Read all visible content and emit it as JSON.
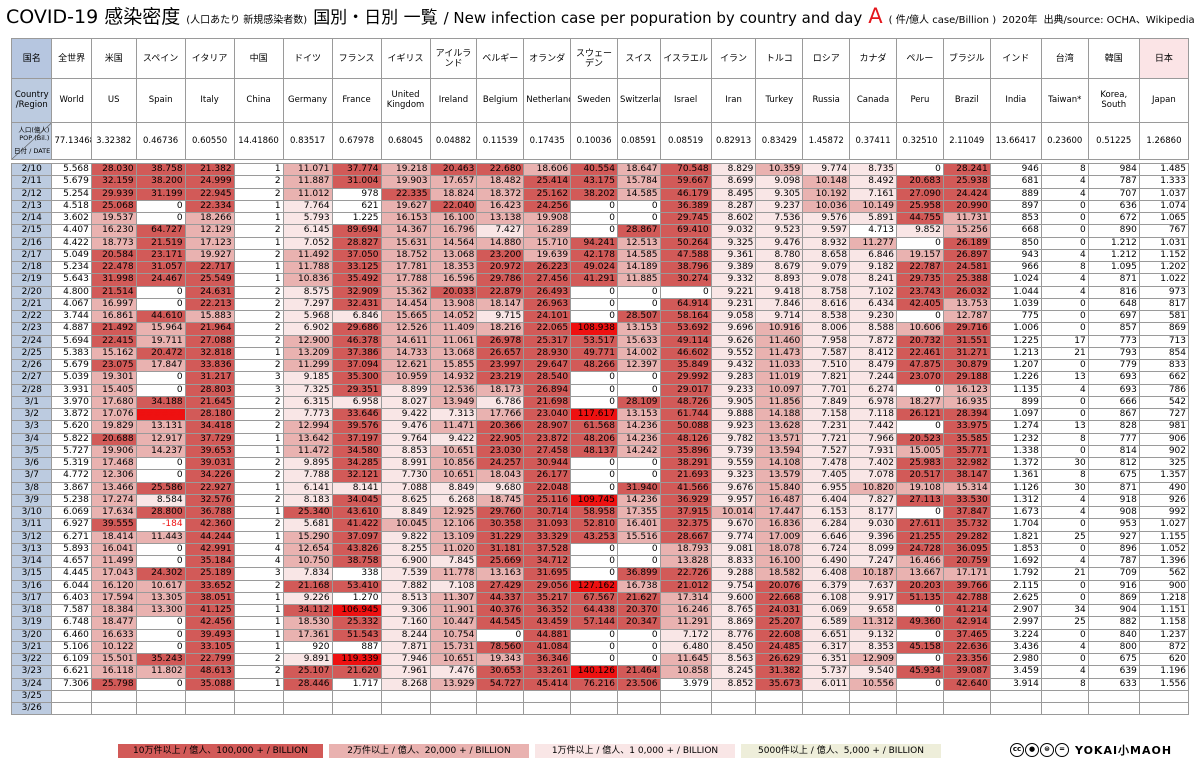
{
  "title": {
    "main": "COVID-19 感染密度",
    "paren": "(人口あたり 新規感染者数)",
    "sub": "国別・日別 一覧",
    "english": "/ New infection case per popuration by country and day",
    "letter": "A",
    "unit": "( 件/億人 case/Billion )",
    "year": "2020年",
    "source": "出典/source: OCHA、Wikipedia"
  },
  "header": {
    "corner_jp": "国名",
    "corner_en": "Country /Region",
    "corner_pop_a": "人口(億人)",
    "corner_pop_b": "POP (Bil.)",
    "corner_date": "日付 / DATE",
    "countries_jp": [
      "全世界",
      "米国",
      "スペイン",
      "イタリア",
      "中国",
      "ドイツ",
      "フランス",
      "イギリス",
      "アイルランド",
      "ベルギー",
      "オランダ",
      "スウェーデン",
      "スイス",
      "イスラエル",
      "イラン",
      "トルコ",
      "ロシア",
      "カナダ",
      "ペルー",
      "ブラジル",
      "インド",
      "台湾",
      "韓国",
      "日本"
    ],
    "countries_en": [
      "World",
      "US",
      "Spain",
      "Italy",
      "China",
      "Germany",
      "France",
      "United Kingdom",
      "Ireland",
      "Belgium",
      "Netherlands",
      "Sweden",
      "Switzerland",
      "Israel",
      "Iran",
      "Turkey",
      "Russia",
      "Canada",
      "Peru",
      "Brazil",
      "India",
      "Taiwan*",
      "Korea, South",
      "Japan"
    ],
    "population": [
      "77.13468",
      "3.32382",
      "0.46736",
      "0.60550",
      "14.41860",
      "0.83517",
      "0.67978",
      "0.68045",
      "0.04882",
      "0.11539",
      "0.17435",
      "0.10036",
      "0.08591",
      "0.08519",
      "0.82913",
      "0.83429",
      "1.45872",
      "0.37411",
      "0.32510",
      "2.11049",
      "13.66417",
      "0.23600",
      "0.51225",
      "1.26860"
    ]
  },
  "rows": [
    [
      "2/10",
      "5.568",
      "28.030",
      "38.758",
      "21.382",
      "1",
      "11.071",
      "37.774",
      "19.218",
      "20.463",
      "22.680",
      "18.606",
      "40.554",
      "18.647",
      "70.548",
      "8.829",
      "10.359",
      "9.774",
      "8.735",
      "0",
      "28.241",
      "946",
      "8",
      "984",
      "1.485"
    ],
    [
      "2/11",
      "5.679",
      "32.159",
      "38.200",
      "24.999",
      "2",
      "11.887",
      "31.004",
      "19.903",
      "17.657",
      "18.482",
      "25.414",
      "43.175",
      "15.784",
      "59.667",
      "8.699",
      "9.098",
      "10.148",
      "8.492",
      "20.683",
      "25.938",
      "681",
      "4",
      "787",
      "1.333"
    ],
    [
      "2/12",
      "5.254",
      "29.939",
      "31.199",
      "22.945",
      "2",
      "11.012",
      "978",
      "22.335",
      "18.824",
      "18.372",
      "25.162",
      "38.202",
      "14.585",
      "46.179",
      "8.495",
      "9.305",
      "10.192",
      "7.161",
      "27.090",
      "24.424",
      "889",
      "4",
      "707",
      "1.037"
    ],
    [
      "2/13",
      "4.518",
      "25.068",
      "0",
      "22.334",
      "1",
      "7.764",
      "621",
      "19.627",
      "22.040",
      "16.423",
      "24.256",
      "0",
      "0",
      "36.389",
      "8.287",
      "9.237",
      "10.036",
      "10.149",
      "25.958",
      "20.990",
      "897",
      "0",
      "636",
      "1.074"
    ],
    [
      "2/14",
      "3.602",
      "19.537",
      "0",
      "18.266",
      "1",
      "5.793",
      "1.225",
      "16.153",
      "16.100",
      "13.138",
      "19.908",
      "0",
      "0",
      "29.745",
      "8.602",
      "7.536",
      "9.576",
      "5.891",
      "44.755",
      "11.731",
      "853",
      "0",
      "672",
      "1.065"
    ],
    [
      "2/15",
      "4.407",
      "16.230",
      "64.727",
      "12.129",
      "2",
      "6.145",
      "89.694",
      "14.367",
      "16.796",
      "7.427",
      "16.289",
      "0",
      "28.867",
      "69.410",
      "9.032",
      "9.523",
      "9.597",
      "4.713",
      "9.852",
      "15.256",
      "668",
      "0",
      "890",
      "767"
    ],
    [
      "2/16",
      "4.422",
      "18.773",
      "21.519",
      "17.123",
      "1",
      "7.052",
      "28.827",
      "15.631",
      "14.564",
      "14.880",
      "15.710",
      "94.241",
      "12.513",
      "50.264",
      "9.325",
      "9.476",
      "8.932",
      "11.277",
      "0",
      "26.189",
      "850",
      "0",
      "1.212",
      "1.031"
    ],
    [
      "2/17",
      "5.049",
      "20.584",
      "23.171",
      "19.927",
      "2",
      "11.492",
      "37.050",
      "18.752",
      "13.068",
      "23.200",
      "19.639",
      "42.178",
      "14.585",
      "47.588",
      "9.361",
      "8.780",
      "8.658",
      "6.846",
      "19.157",
      "26.897",
      "943",
      "4",
      "1.212",
      "1.152"
    ],
    [
      "2/18",
      "5.234",
      "22.478",
      "31.057",
      "22.717",
      "1",
      "11.788",
      "33.125",
      "17.781",
      "18.353",
      "20.972",
      "26.223",
      "49.024",
      "14.189",
      "38.796",
      "9.389",
      "8.679",
      "9.079",
      "9.182",
      "22.787",
      "24.581",
      "966",
      "8",
      "1.095",
      "1.202"
    ],
    [
      "2/19",
      "5.643",
      "31.998",
      "24.467",
      "25.549",
      "1",
      "10.836",
      "35.492",
      "17.788",
      "16.596",
      "29.786",
      "27.456",
      "41.291",
      "11.885",
      "30.274",
      "9.332",
      "8.893",
      "9.078",
      "8.241",
      "29.735",
      "25.388",
      "1.024",
      "4",
      "871",
      "1.022"
    ],
    [
      "2/20",
      "4.800",
      "21.514",
      "0",
      "24.631",
      "2",
      "8.575",
      "32.909",
      "15.362",
      "20.033",
      "22.879",
      "26.493",
      "0",
      "0",
      "0",
      "9.221",
      "9.418",
      "8.758",
      "7.102",
      "23.743",
      "26.032",
      "1.044",
      "4",
      "816",
      "973"
    ],
    [
      "2/21",
      "4.067",
      "16.997",
      "0",
      "22.213",
      "2",
      "7.297",
      "32.431",
      "14.454",
      "13.908",
      "18.147",
      "26.963",
      "0",
      "0",
      "64.914",
      "9.231",
      "7.846",
      "8.616",
      "6.434",
      "42.405",
      "13.753",
      "1.039",
      "0",
      "648",
      "817"
    ],
    [
      "2/22",
      "3.744",
      "16.861",
      "44.610",
      "15.883",
      "2",
      "5.968",
      "6.846",
      "15.665",
      "14.052",
      "9.715",
      "24.101",
      "0",
      "28.507",
      "58.164",
      "9.058",
      "9.714",
      "8.538",
      "9.230",
      "0",
      "12.787",
      "775",
      "0",
      "697",
      "581"
    ],
    [
      "2/23",
      "4.887",
      "21.492",
      "15.964",
      "21.964",
      "2",
      "6.902",
      "29.686",
      "12.526",
      "11.409",
      "18.216",
      "22.065",
      "108.938",
      "13.153",
      "53.692",
      "9.696",
      "10.916",
      "8.006",
      "8.588",
      "10.606",
      "29.716",
      "1.006",
      "0",
      "857",
      "869"
    ],
    [
      "2/24",
      "5.694",
      "22.415",
      "19.711",
      "27.088",
      "2",
      "12.900",
      "46.378",
      "14.611",
      "11.061",
      "26.978",
      "25.317",
      "53.517",
      "15.633",
      "49.114",
      "9.626",
      "11.460",
      "7.958",
      "7.872",
      "20.732",
      "31.551",
      "1.225",
      "17",
      "773",
      "713"
    ],
    [
      "2/25",
      "5.383",
      "15.162",
      "20.472",
      "32.818",
      "1",
      "13.209",
      "37.386",
      "14.733",
      "13.068",
      "26.657",
      "28.930",
      "49.771",
      "14.002",
      "46.602",
      "9.552",
      "11.473",
      "7.587",
      "8.412",
      "22.461",
      "31.271",
      "1.213",
      "21",
      "793",
      "854"
    ],
    [
      "2/26",
      "5.679",
      "23.075",
      "17.847",
      "33.836",
      "2",
      "11.299",
      "37.094",
      "12.621",
      "15.855",
      "23.997",
      "29.647",
      "48.266",
      "12.397",
      "35.849",
      "9.432",
      "11.033",
      "7.510",
      "8.479",
      "47.875",
      "30.879",
      "1.207",
      "0",
      "779",
      "833"
    ],
    [
      "2/27",
      "5.039",
      "19.301",
      "0",
      "31.217",
      "3",
      "9.185",
      "35.300",
      "10.959",
      "14.932",
      "23.219",
      "28.540",
      "0",
      "0",
      "29.992",
      "9.283",
      "11.019",
      "7.821",
      "7.244",
      "23.070",
      "29.188",
      "1.226",
      "13",
      "693",
      "662"
    ],
    [
      "2/28",
      "3.931",
      "15.405",
      "0",
      "28.803",
      "3",
      "7.325",
      "29.351",
      "8.899",
      "12.536",
      "18.173",
      "26.894",
      "0",
      "0",
      "29.017",
      "9.233",
      "10.097",
      "7.701",
      "6.274",
      "0",
      "16.123",
      "1.135",
      "4",
      "693",
      "786"
    ],
    [
      "3/1",
      "3.970",
      "17.680",
      "34.188",
      "21.645",
      "2",
      "6.315",
      "6.958",
      "8.027",
      "13.949",
      "6.786",
      "21.698",
      "0",
      "28.109",
      "48.726",
      "9.905",
      "11.856",
      "7.849",
      "6.978",
      "18.277",
      "16.935",
      "899",
      "0",
      "666",
      "542"
    ],
    [
      "3/2",
      "3.872",
      "17.076",
      "######",
      "28.180",
      "2",
      "7.773",
      "33.646",
      "9.422",
      "7.313",
      "17.766",
      "23.040",
      "117.617",
      "13.153",
      "61.744",
      "9.888",
      "14.188",
      "7.158",
      "7.118",
      "26.121",
      "28.394",
      "1.097",
      "0",
      "867",
      "727"
    ],
    [
      "3/3",
      "5.620",
      "19.829",
      "13.131",
      "34.418",
      "2",
      "12.994",
      "39.576",
      "9.476",
      "11.471",
      "20.366",
      "28.907",
      "61.568",
      "14.236",
      "50.088",
      "9.923",
      "13.628",
      "7.231",
      "7.442",
      "0",
      "33.975",
      "1.274",
      "13",
      "828",
      "981"
    ],
    [
      "3/4",
      "5.822",
      "20.688",
      "12.917",
      "37.729",
      "1",
      "13.642",
      "37.197",
      "9.764",
      "9.422",
      "22.905",
      "23.872",
      "48.206",
      "14.236",
      "48.126",
      "9.782",
      "13.571",
      "7.721",
      "7.966",
      "20.523",
      "35.585",
      "1.232",
      "8",
      "777",
      "906"
    ],
    [
      "3/5",
      "5.727",
      "19.906",
      "14.237",
      "39.653",
      "1",
      "11.472",
      "34.580",
      "8.853",
      "10.651",
      "23.030",
      "27.458",
      "48.137",
      "14.242",
      "35.896",
      "9.739",
      "13.594",
      "7.527",
      "7.931",
      "15.005",
      "35.771",
      "1.338",
      "0",
      "814",
      "902"
    ],
    [
      "3/6",
      "5.319",
      "17.468",
      "0",
      "39.031",
      "2",
      "9.895",
      "34.285",
      "8.991",
      "10.856",
      "24.257",
      "30.944",
      "0",
      "0",
      "38.291",
      "9.559",
      "14.108",
      "7.478",
      "7.402",
      "25.983",
      "32.982",
      "1.372",
      "30",
      "812",
      "325"
    ],
    [
      "3/7",
      "4.772",
      "12.306",
      "0",
      "34.226",
      "2",
      "7.788",
      "32.121",
      "7.730",
      "10.651",
      "18.043",
      "26.177",
      "0",
      "0",
      "21.693",
      "9.323",
      "13.579",
      "7.405",
      "7.078",
      "20.517",
      "38.147",
      "1.361",
      "8",
      "675",
      "1.357"
    ],
    [
      "3/8",
      "3.867",
      "13.466",
      "25.586",
      "22.927",
      "1",
      "6.141",
      "8.141",
      "7.088",
      "8.849",
      "9.680",
      "22.048",
      "0",
      "31.940",
      "41.566",
      "9.676",
      "15.840",
      "6.955",
      "10.820",
      "19.108",
      "15.314",
      "1.126",
      "30",
      "871",
      "490"
    ],
    [
      "3/9",
      "5.238",
      "17.274",
      "8.584",
      "32.576",
      "2",
      "8.183",
      "34.045",
      "8.625",
      "6.268",
      "18.745",
      "25.116",
      "109.745",
      "14.236",
      "36.929",
      "9.957",
      "16.487",
      "6.404",
      "7.827",
      "27.113",
      "33.530",
      "1.312",
      "4",
      "918",
      "926"
    ],
    [
      "3/10",
      "6.069",
      "17.634",
      "28.800",
      "36.788",
      "1",
      "25.340",
      "43.610",
      "8.849",
      "12.925",
      "29.760",
      "30.714",
      "58.958",
      "17.355",
      "37.915",
      "10.014",
      "17.447",
      "6.153",
      "8.177",
      "0",
      "37.847",
      "1.673",
      "4",
      "908",
      "992"
    ],
    [
      "3/11",
      "6.927",
      "39.555",
      "-184",
      "42.360",
      "2",
      "5.681",
      "41.422",
      "10.045",
      "12.106",
      "30.358",
      "31.093",
      "52.810",
      "16.401",
      "32.375",
      "9.670",
      "16.836",
      "6.284",
      "9.030",
      "27.611",
      "35.732",
      "1.704",
      "0",
      "953",
      "1.027"
    ],
    [
      "3/12",
      "6.271",
      "18.414",
      "11.443",
      "44.244",
      "1",
      "15.290",
      "37.097",
      "9.822",
      "13.109",
      "31.229",
      "33.329",
      "43.253",
      "15.516",
      "28.667",
      "9.774",
      "17.009",
      "6.646",
      "9.396",
      "21.255",
      "29.282",
      "1.821",
      "25",
      "927",
      "1.155"
    ],
    [
      "3/13",
      "5.893",
      "16.041",
      "0",
      "42.991",
      "4",
      "12.654",
      "43.826",
      "8.255",
      "11.020",
      "31.181",
      "37.528",
      "0",
      "0",
      "18.793",
      "9.081",
      "18.078",
      "6.724",
      "8.099",
      "24.728",
      "36.095",
      "1.853",
      "0",
      "896",
      "1.052"
    ],
    [
      "3/14",
      "4.657",
      "11.499",
      "0",
      "35.184",
      "4",
      "10.750",
      "38.758",
      "6.900",
      "7.845",
      "25.669",
      "34.712",
      "0",
      "0",
      "13.828",
      "8.833",
      "16.100",
      "6.490",
      "7.247",
      "16.466",
      "20.759",
      "1.692",
      "4",
      "787",
      "1.396"
    ],
    [
      "3/15",
      "4.445",
      "17.043",
      "24.302",
      "25.189",
      "3",
      "7.834",
      "338",
      "7.539",
      "11.778",
      "13.163",
      "31.695",
      "0",
      "36.899",
      "22.726",
      "9.288",
      "18.582",
      "6.408",
      "10.187",
      "13.667",
      "17.171",
      "1.792",
      "21",
      "709",
      "562"
    ],
    [
      "3/16",
      "6.044",
      "16.120",
      "10.617",
      "33.652",
      "2",
      "21.168",
      "53.410",
      "7.882",
      "7.108",
      "27.429",
      "29.056",
      "127.162",
      "16.738",
      "21.012",
      "9.754",
      "20.076",
      "6.379",
      "7.637",
      "20.203",
      "39.766",
      "2.115",
      "0",
      "916",
      "900"
    ],
    [
      "3/17",
      "6.403",
      "17.594",
      "13.305",
      "38.051",
      "1",
      "9.226",
      "1.270",
      "8.513",
      "11.307",
      "44.337",
      "35.217",
      "67.567",
      "21.627",
      "17.314",
      "9.600",
      "22.668",
      "6.108",
      "9.917",
      "51.135",
      "42.788",
      "2.625",
      "0",
      "869",
      "1.218"
    ],
    [
      "3/18",
      "7.587",
      "18.384",
      "13.300",
      "41.125",
      "1",
      "34.112",
      "106.945",
      "9.306",
      "11.901",
      "40.376",
      "36.352",
      "64.438",
      "20.370",
      "16.246",
      "8.765",
      "24.031",
      "6.069",
      "9.658",
      "0",
      "41.214",
      "2.907",
      "34",
      "904",
      "1.151"
    ],
    [
      "3/19",
      "6.748",
      "18.477",
      "0",
      "42.456",
      "1",
      "18.530",
      "25.332",
      "7.160",
      "10.447",
      "44.545",
      "43.459",
      "57.144",
      "20.347",
      "11.291",
      "8.869",
      "25.207",
      "6.589",
      "11.312",
      "49.360",
      "42.914",
      "2.997",
      "25",
      "882",
      "1.158"
    ],
    [
      "3/20",
      "6.460",
      "16.633",
      "0",
      "39.493",
      "1",
      "17.361",
      "51.543",
      "8.244",
      "10.754",
      "0",
      "44.881",
      "0",
      "0",
      "7.172",
      "8.776",
      "22.608",
      "6.651",
      "9.132",
      "0",
      "37.465",
      "3.224",
      "0",
      "840",
      "1.237"
    ],
    [
      "3/21",
      "5.106",
      "10.122",
      "0",
      "33.105",
      "1",
      "920",
      "887",
      "7.871",
      "15.731",
      "78.560",
      "41.084",
      "0",
      "0",
      "6.480",
      "8.450",
      "24.485",
      "6.317",
      "8.353",
      "45.158",
      "22.636",
      "3.436",
      "4",
      "800",
      "872"
    ],
    [
      "3/22",
      "6.109",
      "15.501",
      "35.243",
      "22.799",
      "2",
      "9.891",
      "119.339",
      "7.946",
      "10.651",
      "19.343",
      "36.346",
      "0",
      "0",
      "11.645",
      "8.563",
      "26.629",
      "6.351",
      "12.909",
      "0",
      "23.356",
      "2.980",
      "0",
      "675",
      "620"
    ],
    [
      "3/23",
      "6.621",
      "16.118",
      "11.802",
      "48.613",
      "2",
      "25.107",
      "21.620",
      "7.961",
      "7.476",
      "30.653",
      "33.261",
      "140.126",
      "21.464",
      "10.858",
      "8.245",
      "31.382",
      "5.737",
      "9.540",
      "45.934",
      "39.087",
      "3.459",
      "4",
      "639",
      "1.196"
    ],
    [
      "3/24",
      "7.306",
      "25.798",
      "0",
      "35.088",
      "1",
      "28.446",
      "1.717",
      "8.268",
      "13.929",
      "54.727",
      "45.414",
      "76.216",
      "23.506",
      "3.979",
      "8.852",
      "35.673",
      "6.011",
      "10.556",
      "0",
      "42.640",
      "3.914",
      "8",
      "633",
      "1.556"
    ],
    [
      "3/25",
      "",
      "",
      "",
      "",
      "",
      "",
      "",
      "",
      "",
      "",
      "",
      "",
      "",
      "",
      "",
      "",
      "",
      "",
      "",
      "",
      "",
      "",
      "",
      ""
    ],
    [
      "3/26",
      "",
      "",
      "",
      "",
      "",
      "",
      "",
      "",
      "",
      "",
      "",
      "",
      "",
      "",
      "",
      "",
      "",
      "",
      "",
      "",
      "",
      "",
      "",
      ""
    ]
  ],
  "colors": {
    "over_100000": "#ee1111",
    "over_100000_legend": "#d25a58",
    "over_20000": "#d25a58",
    "over_10000": "#e9b2b0",
    "over_5000": "#f9e6e6",
    "header_blue": "#bccbe0",
    "japan_header": "#fbe4e6"
  },
  "legend": {
    "l1": "10万件以上 / 億人、100,000 + / BILLION",
    "l2": "2万件以上 / 億人、20,000 + / BILLION",
    "l3": "1万件以上 / 億人、1 0,000 + / BILLION",
    "l4": "5000件以上 / 億人、5,000 + / BILLION"
  },
  "footer": {
    "cc_icons": [
      "cc-icon",
      "by-icon",
      "nd-icon",
      "equal-icon"
    ],
    "brand": "YOKAI小MAOH"
  }
}
